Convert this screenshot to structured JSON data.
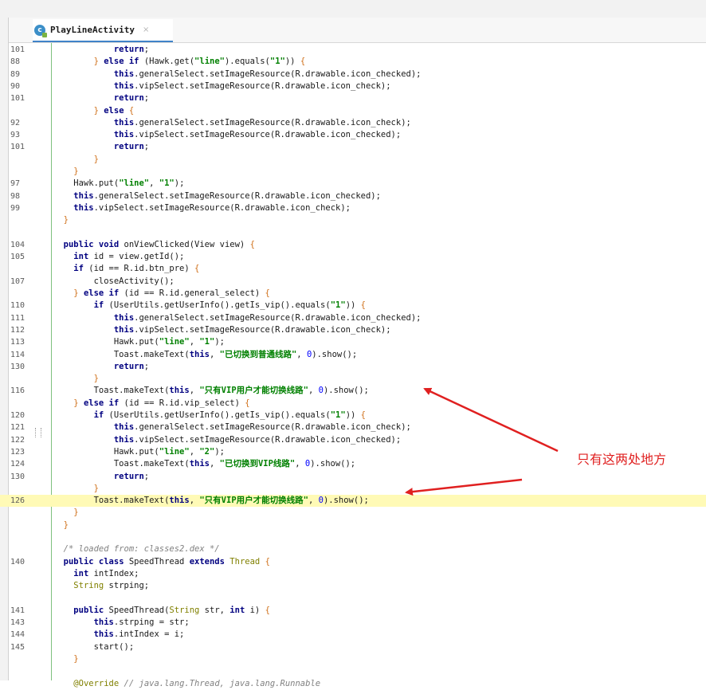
{
  "editor": {
    "tab_label": "PlayLineActivity",
    "tab_close": "×",
    "file_icon_letter": "c"
  },
  "colors": {
    "keyword": "#000080",
    "string": "#008000",
    "number": "#0000ff",
    "comment": "#808080",
    "highlight_line": "#fffab6",
    "annotation": "#e02020",
    "tab_underline": "#4083c9"
  },
  "icons": {
    "file": "java-class-icon",
    "close": "close-icon",
    "arrows": "red-arrow-icon"
  },
  "code_lines": [
    {
      "ln": "101",
      "tokens": [
        [
          "",
          "            "
        ],
        [
          "kw",
          "return"
        ],
        [
          "",
          ";"
        ]
      ]
    },
    {
      "ln": "88",
      "tokens": [
        [
          "",
          "        "
        ],
        [
          "brace",
          "}"
        ],
        [
          "",
          " "
        ],
        [
          "kw",
          "else if"
        ],
        [
          "",
          " (Hawk.get("
        ],
        [
          "str",
          "\"line\""
        ],
        [
          "",
          ").equals("
        ],
        [
          "str",
          "\"1\""
        ],
        [
          "",
          ")) "
        ],
        [
          "brace",
          "{"
        ]
      ]
    },
    {
      "ln": "89",
      "tokens": [
        [
          "",
          "            "
        ],
        [
          "kw",
          "this"
        ],
        [
          "",
          ".generalSelect.setImageResource(R.drawable.icon_checked);"
        ]
      ]
    },
    {
      "ln": "90",
      "tokens": [
        [
          "",
          "            "
        ],
        [
          "kw",
          "this"
        ],
        [
          "",
          ".vipSelect.setImageResource(R.drawable.icon_check);"
        ]
      ]
    },
    {
      "ln": "101",
      "tokens": [
        [
          "",
          "            "
        ],
        [
          "kw",
          "return"
        ],
        [
          "",
          ";"
        ]
      ]
    },
    {
      "ln": "",
      "tokens": [
        [
          "",
          "        "
        ],
        [
          "brace",
          "}"
        ],
        [
          "",
          " "
        ],
        [
          "kw",
          "else"
        ],
        [
          "",
          " "
        ],
        [
          "brace",
          "{"
        ]
      ]
    },
    {
      "ln": "92",
      "tokens": [
        [
          "",
          "            "
        ],
        [
          "kw",
          "this"
        ],
        [
          "",
          ".generalSelect.setImageResource(R.drawable.icon_check);"
        ]
      ]
    },
    {
      "ln": "93",
      "tokens": [
        [
          "",
          "            "
        ],
        [
          "kw",
          "this"
        ],
        [
          "",
          ".vipSelect.setImageResource(R.drawable.icon_checked);"
        ]
      ]
    },
    {
      "ln": "101",
      "tokens": [
        [
          "",
          "            "
        ],
        [
          "kw",
          "return"
        ],
        [
          "",
          ";"
        ]
      ]
    },
    {
      "ln": "",
      "tokens": [
        [
          "",
          "        "
        ],
        [
          "brace",
          "}"
        ]
      ]
    },
    {
      "ln": "",
      "tokens": [
        [
          "",
          "    "
        ],
        [
          "brace",
          "}"
        ]
      ]
    },
    {
      "ln": "97",
      "tokens": [
        [
          "",
          "    Hawk.put("
        ],
        [
          "str",
          "\"line\""
        ],
        [
          "",
          ", "
        ],
        [
          "str",
          "\"1\""
        ],
        [
          "",
          ");"
        ]
      ]
    },
    {
      "ln": "98",
      "tokens": [
        [
          "",
          "    "
        ],
        [
          "kw",
          "this"
        ],
        [
          "",
          ".generalSelect.setImageResource(R.drawable.icon_checked);"
        ]
      ]
    },
    {
      "ln": "99",
      "tokens": [
        [
          "",
          "    "
        ],
        [
          "kw",
          "this"
        ],
        [
          "",
          ".vipSelect.setImageResource(R.drawable.icon_check);"
        ]
      ]
    },
    {
      "ln": "",
      "tokens": [
        [
          "",
          "  "
        ],
        [
          "brace",
          "}"
        ]
      ]
    },
    {
      "ln": "",
      "tokens": []
    },
    {
      "ln": "104",
      "tokens": [
        [
          "",
          "  "
        ],
        [
          "kw",
          "public void"
        ],
        [
          "",
          " onViewClicked(View view) "
        ],
        [
          "brace",
          "{"
        ]
      ]
    },
    {
      "ln": "105",
      "tokens": [
        [
          "",
          "    "
        ],
        [
          "kw",
          "int"
        ],
        [
          "",
          " id = view.getId();"
        ]
      ]
    },
    {
      "ln": "",
      "tokens": [
        [
          "",
          "    "
        ],
        [
          "kw",
          "if"
        ],
        [
          "",
          " (id == R.id.btn_pre) "
        ],
        [
          "brace",
          "{"
        ]
      ]
    },
    {
      "ln": "107",
      "tokens": [
        [
          "",
          "        closeActivity();"
        ]
      ]
    },
    {
      "ln": "",
      "tokens": [
        [
          "",
          "    "
        ],
        [
          "brace",
          "}"
        ],
        [
          "",
          " "
        ],
        [
          "kw",
          "else if"
        ],
        [
          "",
          " (id == R.id.general_select) "
        ],
        [
          "brace",
          "{"
        ]
      ]
    },
    {
      "ln": "110",
      "tokens": [
        [
          "",
          "        "
        ],
        [
          "kw",
          "if"
        ],
        [
          "",
          " (UserUtils.getUserInfo().getIs_vip().equals("
        ],
        [
          "str",
          "\"1\""
        ],
        [
          "",
          ")) "
        ],
        [
          "brace",
          "{"
        ]
      ]
    },
    {
      "ln": "111",
      "tokens": [
        [
          "",
          "            "
        ],
        [
          "kw",
          "this"
        ],
        [
          "",
          ".generalSelect.setImageResource(R.drawable.icon_checked);"
        ]
      ]
    },
    {
      "ln": "112",
      "tokens": [
        [
          "",
          "            "
        ],
        [
          "kw",
          "this"
        ],
        [
          "",
          ".vipSelect.setImageResource(R.drawable.icon_check);"
        ]
      ]
    },
    {
      "ln": "113",
      "tokens": [
        [
          "",
          "            Hawk.put("
        ],
        [
          "str",
          "\"line\""
        ],
        [
          "",
          ", "
        ],
        [
          "str",
          "\"1\""
        ],
        [
          "",
          ");"
        ]
      ]
    },
    {
      "ln": "114",
      "tokens": [
        [
          "",
          "            Toast.makeText("
        ],
        [
          "kw",
          "this"
        ],
        [
          "",
          ", "
        ],
        [
          "str",
          "\"已切换到普通线路\""
        ],
        [
          "",
          ", "
        ],
        [
          "num",
          "0"
        ],
        [
          "",
          ").show();"
        ]
      ]
    },
    {
      "ln": "130",
      "tokens": [
        [
          "",
          "            "
        ],
        [
          "kw",
          "return"
        ],
        [
          "",
          ";"
        ]
      ]
    },
    {
      "ln": "",
      "tokens": [
        [
          "",
          "        "
        ],
        [
          "brace",
          "}"
        ]
      ]
    },
    {
      "ln": "116",
      "tokens": [
        [
          "",
          "        Toast.makeText("
        ],
        [
          "kw",
          "this"
        ],
        [
          "",
          ", "
        ],
        [
          "str",
          "\"只有VIP用户才能切换线路\""
        ],
        [
          "",
          ", "
        ],
        [
          "num",
          "0"
        ],
        [
          "",
          ").show();"
        ]
      ]
    },
    {
      "ln": "",
      "tokens": [
        [
          "",
          "    "
        ],
        [
          "brace",
          "}"
        ],
        [
          "",
          " "
        ],
        [
          "kw",
          "else if"
        ],
        [
          "",
          " (id == R.id.vip_select) "
        ],
        [
          "brace",
          "{"
        ]
      ]
    },
    {
      "ln": "120",
      "tokens": [
        [
          "",
          "        "
        ],
        [
          "kw",
          "if"
        ],
        [
          "",
          " (UserUtils.getUserInfo().getIs_vip().equals("
        ],
        [
          "str",
          "\"1\""
        ],
        [
          "",
          ")) "
        ],
        [
          "brace",
          "{"
        ]
      ]
    },
    {
      "ln": "121",
      "tokens": [
        [
          "",
          "            "
        ],
        [
          "kw",
          "this"
        ],
        [
          "",
          ".generalSelect.setImageResource(R.drawable.icon_check);"
        ]
      ]
    },
    {
      "ln": "122",
      "tokens": [
        [
          "",
          "            "
        ],
        [
          "kw",
          "this"
        ],
        [
          "",
          ".vipSelect.setImageResource(R.drawable.icon_checked);"
        ]
      ]
    },
    {
      "ln": "123",
      "tokens": [
        [
          "",
          "            Hawk.put("
        ],
        [
          "str",
          "\"line\""
        ],
        [
          "",
          ", "
        ],
        [
          "str",
          "\"2\""
        ],
        [
          "",
          ");"
        ]
      ]
    },
    {
      "ln": "124",
      "tokens": [
        [
          "",
          "            Toast.makeText("
        ],
        [
          "kw",
          "this"
        ],
        [
          "",
          ", "
        ],
        [
          "str",
          "\"已切换到VIP线路\""
        ],
        [
          "",
          ", "
        ],
        [
          "num",
          "0"
        ],
        [
          "",
          ").show();"
        ]
      ]
    },
    {
      "ln": "130",
      "tokens": [
        [
          "",
          "            "
        ],
        [
          "kw",
          "return"
        ],
        [
          "",
          ";"
        ]
      ]
    },
    {
      "ln": "",
      "tokens": [
        [
          "",
          "        "
        ],
        [
          "brace",
          "}"
        ]
      ]
    },
    {
      "ln": "126",
      "highlight": true,
      "tokens": [
        [
          "",
          "        Toast.makeText("
        ],
        [
          "kw",
          "this"
        ],
        [
          "",
          ", "
        ],
        [
          "str",
          "\"只有VIP用户才能切换线路\""
        ],
        [
          "",
          ", "
        ],
        [
          "num",
          "0"
        ],
        [
          "",
          ").show();"
        ]
      ]
    },
    {
      "ln": "",
      "tokens": [
        [
          "",
          "    "
        ],
        [
          "brace",
          "}"
        ]
      ]
    },
    {
      "ln": "",
      "tokens": [
        [
          "",
          "  "
        ],
        [
          "brace",
          "}"
        ]
      ]
    },
    {
      "ln": "",
      "tokens": []
    },
    {
      "ln": "",
      "tokens": [
        [
          "",
          "  "
        ],
        [
          "cmt",
          "/* loaded from: classes2.dex */"
        ]
      ]
    },
    {
      "ln": "140",
      "tokens": [
        [
          "",
          "  "
        ],
        [
          "kw",
          "public class"
        ],
        [
          "",
          " SpeedThread "
        ],
        [
          "kw",
          "extends"
        ],
        [
          "",
          " "
        ],
        [
          "cls",
          "Thread"
        ],
        [
          "",
          " "
        ],
        [
          "brace",
          "{"
        ]
      ]
    },
    {
      "ln": "",
      "tokens": [
        [
          "",
          "    "
        ],
        [
          "kw",
          "int"
        ],
        [
          "",
          " intIndex;"
        ]
      ]
    },
    {
      "ln": "",
      "tokens": [
        [
          "",
          "    "
        ],
        [
          "cls",
          "String"
        ],
        [
          "",
          " strping;"
        ]
      ]
    },
    {
      "ln": "",
      "tokens": []
    },
    {
      "ln": "141",
      "tokens": [
        [
          "",
          "    "
        ],
        [
          "kw",
          "public"
        ],
        [
          "",
          " SpeedThread("
        ],
        [
          "cls",
          "String"
        ],
        [
          "",
          " str, "
        ],
        [
          "kw",
          "int"
        ],
        [
          "",
          " i) "
        ],
        [
          "brace",
          "{"
        ]
      ]
    },
    {
      "ln": "143",
      "tokens": [
        [
          "",
          "        "
        ],
        [
          "kw",
          "this"
        ],
        [
          "",
          ".strping = str;"
        ]
      ]
    },
    {
      "ln": "144",
      "tokens": [
        [
          "",
          "        "
        ],
        [
          "kw",
          "this"
        ],
        [
          "",
          ".intIndex = i;"
        ]
      ]
    },
    {
      "ln": "145",
      "tokens": [
        [
          "",
          "        start();"
        ]
      ]
    },
    {
      "ln": "",
      "tokens": [
        [
          "",
          "    "
        ],
        [
          "brace",
          "}"
        ]
      ]
    },
    {
      "ln": "",
      "tokens": []
    },
    {
      "ln": "",
      "tokens": [
        [
          "",
          "    "
        ],
        [
          "ann",
          "@Override"
        ],
        [
          "",
          " "
        ],
        [
          "cmt",
          "// java.lang.Thread, java.lang.Runnable"
        ]
      ]
    }
  ],
  "annotation": {
    "text": "只有这两处地方"
  }
}
